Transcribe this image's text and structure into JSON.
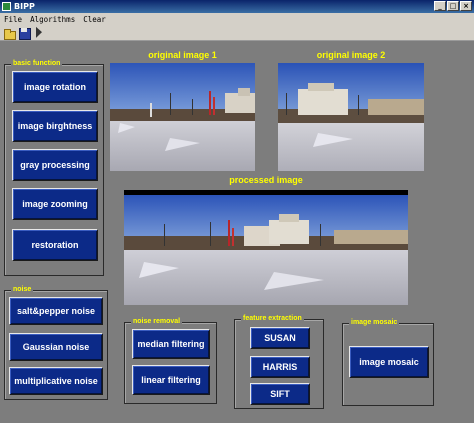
{
  "window": {
    "title": "BIPP",
    "min": "_",
    "max": "□",
    "close": "×"
  },
  "menu": [
    "File",
    "Algorithms",
    "Clear"
  ],
  "toolbar": [
    "open-icon",
    "save-icon",
    "pointer-icon"
  ],
  "colors": {
    "background": "#7d7d7d",
    "button": "#0c2a88",
    "label": "#ffff00",
    "button_text": "#ffffff"
  },
  "images": {
    "original1_caption": "original image 1",
    "original2_caption": "original image 2",
    "processed_caption": "processed image"
  },
  "panels": {
    "basic": {
      "title": "basic function",
      "buttons": [
        "image rotation",
        "image birghtness",
        "gray processing",
        "image zooming",
        "restoration"
      ]
    },
    "noise": {
      "title": "noise",
      "buttons": [
        "salt&pepper noise",
        "Gaussian noise",
        "multiplicative noise"
      ]
    },
    "noise_removal": {
      "title": "noise removal",
      "buttons": [
        "median filtering",
        "linear filtering"
      ]
    },
    "feature": {
      "title": "feature extraction",
      "buttons": [
        "SUSAN",
        "HARRIS",
        "SIFT"
      ]
    },
    "mosaic": {
      "title": "image mosaic",
      "buttons": [
        "image mosaic"
      ]
    }
  }
}
